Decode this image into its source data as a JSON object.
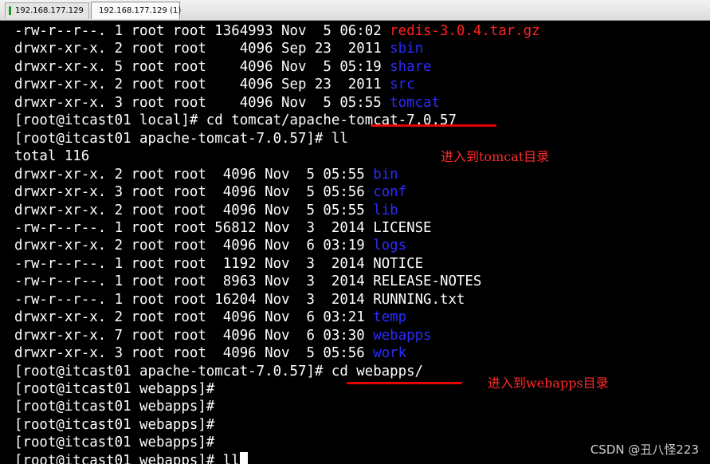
{
  "tabs": [
    {
      "label": "192.168.177.129"
    },
    {
      "label": "192.168.177.129 (1)"
    }
  ],
  "terminal": {
    "lines": [
      {
        "text": "-rw-r--r--. 1 root root 1364993 Nov  5 06:02 ",
        "name": "redis-3.0.4.tar.gz",
        "color": "#ff2020"
      },
      {
        "text": "drwxr-xr-x. 2 root root    4096 Sep 23  2011 ",
        "name": "sbin",
        "color": "#2c2cff"
      },
      {
        "text": "drwxr-xr-x. 5 root root    4096 Nov  5 05:19 ",
        "name": "share",
        "color": "#2c2cff"
      },
      {
        "text": "drwxr-xr-x. 2 root root    4096 Sep 23  2011 ",
        "name": "src",
        "color": "#2c2cff"
      },
      {
        "text": "drwxr-xr-x. 3 root root    4096 Nov  5 05:55 ",
        "name": "tomcat",
        "color": "#2c2cff"
      },
      {
        "text": "[root@itcast01 local]# cd tomcat/apache-tomcat-7.0.57",
        "name": "",
        "color": "#ffffff"
      },
      {
        "text": "[root@itcast01 apache-tomcat-7.0.57]# ll",
        "name": "",
        "color": "#ffffff"
      },
      {
        "text": "total 116",
        "name": "",
        "color": "#ffffff"
      },
      {
        "text": "drwxr-xr-x. 2 root root  4096 Nov  5 05:55 ",
        "name": "bin",
        "color": "#2c2cff"
      },
      {
        "text": "drwxr-xr-x. 3 root root  4096 Nov  5 05:56 ",
        "name": "conf",
        "color": "#2c2cff"
      },
      {
        "text": "drwxr-xr-x. 2 root root  4096 Nov  5 05:55 ",
        "name": "lib",
        "color": "#2c2cff"
      },
      {
        "text": "-rw-r--r--. 1 root root 56812 Nov  3  2014 ",
        "name": "LICENSE",
        "color": "#ffffff"
      },
      {
        "text": "drwxr-xr-x. 2 root root  4096 Nov  6 03:19 ",
        "name": "logs",
        "color": "#2c2cff"
      },
      {
        "text": "-rw-r--r--. 1 root root  1192 Nov  3  2014 ",
        "name": "NOTICE",
        "color": "#ffffff"
      },
      {
        "text": "-rw-r--r--. 1 root root  8963 Nov  3  2014 ",
        "name": "RELEASE-NOTES",
        "color": "#ffffff"
      },
      {
        "text": "-rw-r--r--. 1 root root 16204 Nov  3  2014 ",
        "name": "RUNNING.txt",
        "color": "#ffffff"
      },
      {
        "text": "drwxr-xr-x. 2 root root  4096 Nov  6 03:21 ",
        "name": "temp",
        "color": "#2c2cff"
      },
      {
        "text": "drwxr-xr-x. 7 root root  4096 Nov  6 03:30 ",
        "name": "webapps",
        "color": "#2c2cff"
      },
      {
        "text": "drwxr-xr-x. 3 root root  4096 Nov  5 05:56 ",
        "name": "work",
        "color": "#2c2cff"
      },
      {
        "text": "[root@itcast01 apache-tomcat-7.0.57]# cd webapps/",
        "name": "",
        "color": "#ffffff"
      },
      {
        "text": "[root@itcast01 webapps]#",
        "name": "",
        "color": "#ffffff"
      },
      {
        "text": "[root@itcast01 webapps]#",
        "name": "",
        "color": "#ffffff"
      },
      {
        "text": "[root@itcast01 webapps]#",
        "name": "",
        "color": "#ffffff"
      },
      {
        "text": "[root@itcast01 webapps]#",
        "name": "",
        "color": "#ffffff"
      },
      {
        "text": "[root@itcast01 webapps]# ll",
        "name": "",
        "color": "#ffffff"
      }
    ]
  },
  "annotations": {
    "tomcat_note": "进入到tomcat目录",
    "webapps_note": "进入到webapps目录",
    "underline_color": "#e60000"
  },
  "watermark": "CSDN @丑八怪223",
  "icons": {
    "tab_indicator": "connection-status-icon"
  }
}
